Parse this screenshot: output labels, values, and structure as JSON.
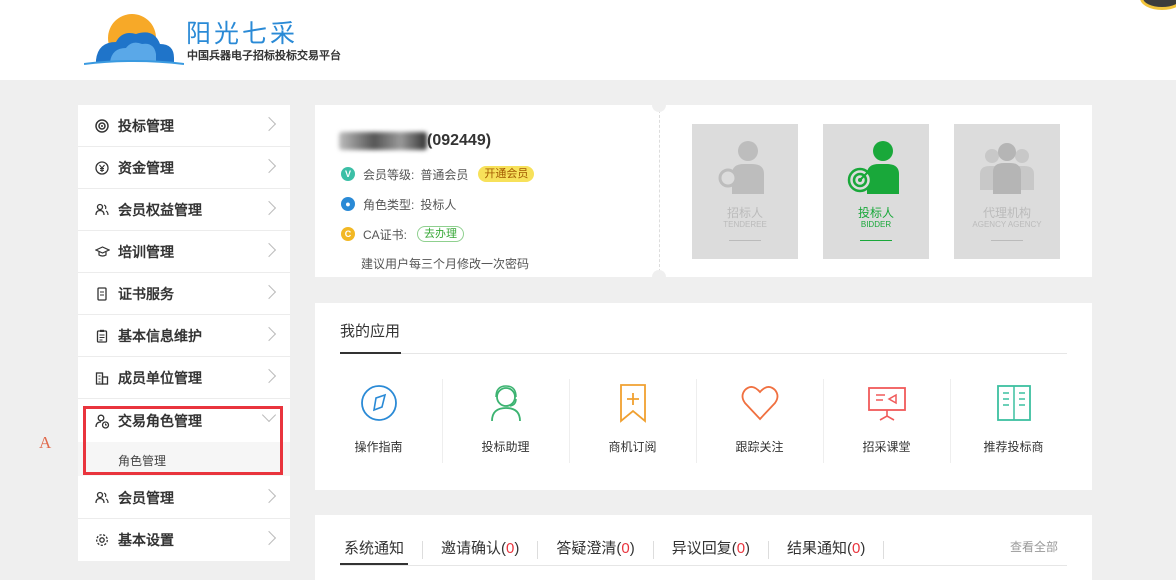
{
  "header": {
    "brand_title": "阳光七采",
    "brand_subtitle": "中国兵器电子招标投标交易平台"
  },
  "sidebar": {
    "items": [
      {
        "label": "投标管理",
        "icon": "target-icon"
      },
      {
        "label": "资金管理",
        "icon": "yen-icon"
      },
      {
        "label": "会员权益管理",
        "icon": "user-group-icon"
      },
      {
        "label": "培训管理",
        "icon": "graduation-cap-icon"
      },
      {
        "label": "证书服务",
        "icon": "certificate-icon"
      },
      {
        "label": "基本信息维护",
        "icon": "clipboard-icon"
      },
      {
        "label": "成员单位管理",
        "icon": "building-icon"
      },
      {
        "label": "交易角色管理",
        "icon": "user-lock-icon",
        "expanded": true
      },
      {
        "label": "会员管理",
        "icon": "user-group-icon"
      },
      {
        "label": "基本设置",
        "icon": "gear-icon"
      }
    ],
    "sub_item_label": "角色管理",
    "annotation_marker": "A"
  },
  "profile": {
    "member_id": "(092449)",
    "level_label": "会员等级:",
    "level_value": "普通会员",
    "level_button": "开通会员",
    "role_label": "角色类型:",
    "role_value": "投标人",
    "ca_label": "CA证书:",
    "ca_button": "去办理",
    "password_tip": "建议用户每三个月修改一次密码",
    "roles": [
      {
        "name": "招标人",
        "en": "TENDEREE",
        "active": false
      },
      {
        "name": "投标人",
        "en": "BIDDER",
        "active": true
      },
      {
        "name": "代理机构",
        "en": "AGENCY AGENCY",
        "active": false
      }
    ]
  },
  "apps": {
    "title": "我的应用",
    "items": [
      {
        "label": "操作指南",
        "icon": "compass-icon",
        "color": "#2a8ad6"
      },
      {
        "label": "投标助理",
        "icon": "assistant-icon",
        "color": "#3cb371"
      },
      {
        "label": "商机订阅",
        "icon": "bookmark-plus-icon",
        "color": "#f0a030"
      },
      {
        "label": "跟踪关注",
        "icon": "heart-icon",
        "color": "#f07040"
      },
      {
        "label": "招采课堂",
        "icon": "presentation-icon",
        "color": "#f05a5a"
      },
      {
        "label": "推荐投标商",
        "icon": "book-icon",
        "color": "#3cc0a0"
      }
    ]
  },
  "notices": {
    "tabs": [
      {
        "label": "系统通知",
        "count": ""
      },
      {
        "label": "邀请确认(",
        "count": "0",
        "close": ")"
      },
      {
        "label": "答疑澄清(",
        "count": "0",
        "close": ")"
      },
      {
        "label": "异议回复(",
        "count": "0",
        "close": ")"
      },
      {
        "label": "结果通知(",
        "count": "0",
        "close": ")"
      }
    ],
    "view_all": "查看全部"
  }
}
